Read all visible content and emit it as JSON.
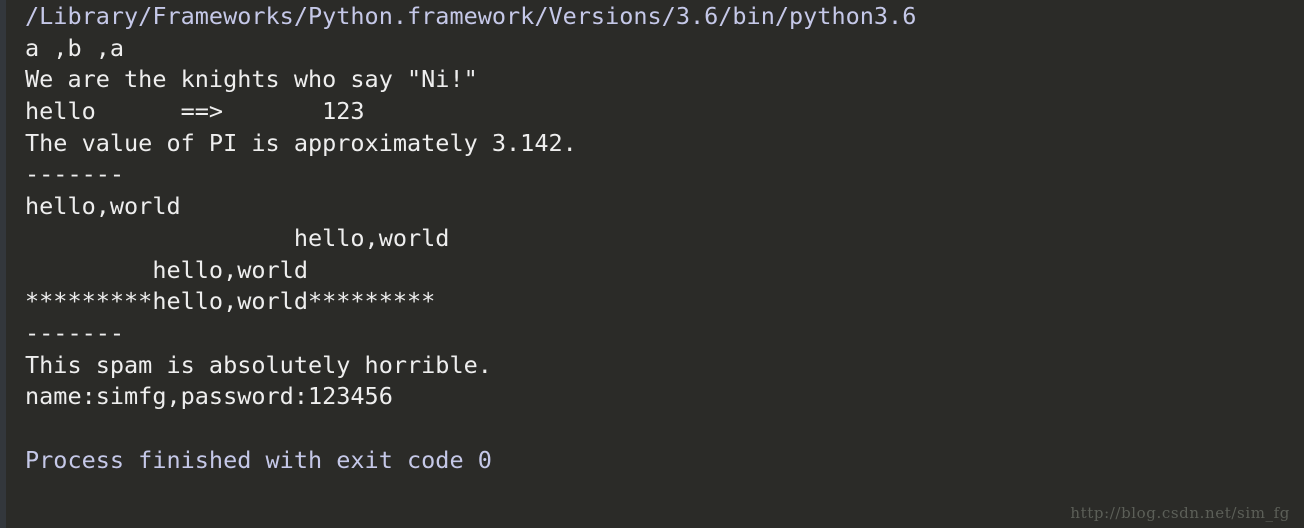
{
  "console": {
    "title": "Run console output",
    "background_color": "#2b2b28",
    "gutter_color": "#33373c",
    "default_text_color": "#eeeeee",
    "command_text_color": "#c5c8e8",
    "lines": [
      {
        "text": "/Library/Frameworks/Python.framework/Versions/3.6/bin/python3.6",
        "kind": "cmd"
      },
      {
        "text": "a ,b ,a",
        "kind": "out"
      },
      {
        "text": "We are the knights who say \"Ni!\"",
        "kind": "out"
      },
      {
        "text": "hello      ==>       123",
        "kind": "out"
      },
      {
        "text": "The value of PI is approximately 3.142.",
        "kind": "out"
      },
      {
        "text": "-------",
        "kind": "out"
      },
      {
        "text": "hello,world",
        "kind": "out"
      },
      {
        "text": "                   hello,world",
        "kind": "out"
      },
      {
        "text": "         hello,world",
        "kind": "out"
      },
      {
        "text": "*********hello,world*********",
        "kind": "out"
      },
      {
        "text": "-------",
        "kind": "out"
      },
      {
        "text": "This spam is absolutely horrible.",
        "kind": "out"
      },
      {
        "text": "name:simfg,password:123456",
        "kind": "out"
      },
      {
        "text": "",
        "kind": "blank"
      },
      {
        "text": "Process finished with exit code 0",
        "kind": "result"
      }
    ]
  },
  "watermark": {
    "text": "http://blog.csdn.net/sim_fg",
    "color": "#5c5f58"
  }
}
